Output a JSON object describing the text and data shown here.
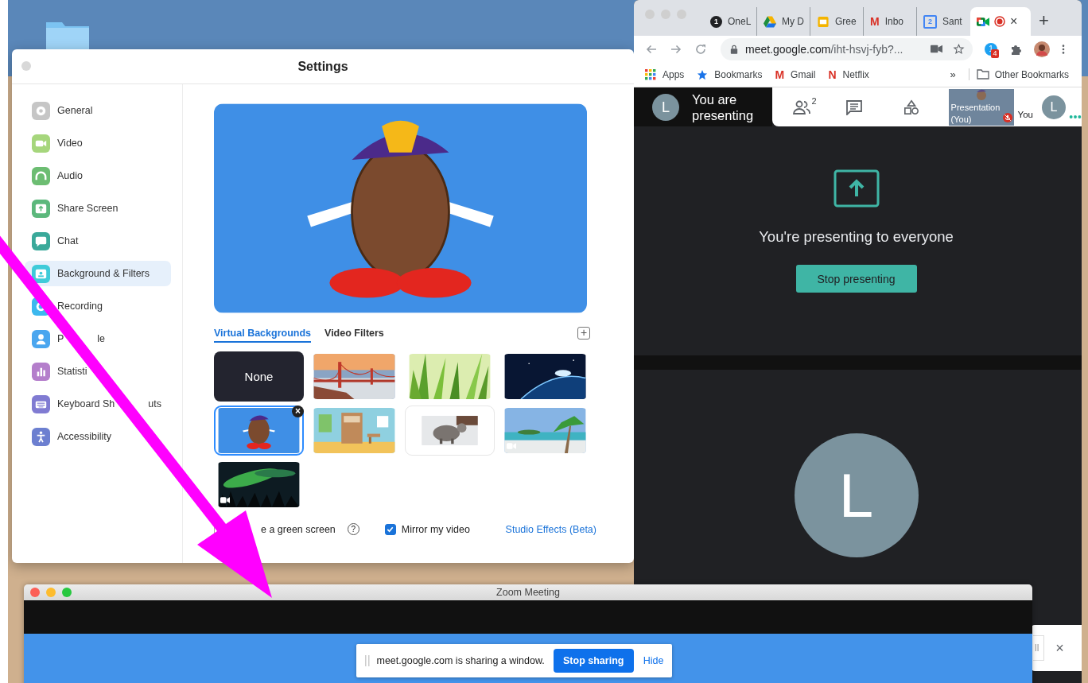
{
  "settings": {
    "title": "Settings",
    "sidebar": [
      {
        "label": "General",
        "kind": "gear",
        "color": "#c6c6c6",
        "selected": false
      },
      {
        "label": "Video",
        "kind": "video",
        "color": "#a6d67c",
        "selected": false
      },
      {
        "label": "Audio",
        "kind": "headphones",
        "color": "#6cbd72",
        "selected": false
      },
      {
        "label": "Share Screen",
        "kind": "share",
        "color": "#5cb87c",
        "selected": false
      },
      {
        "label": "Chat",
        "kind": "chat",
        "color": "#3aa99a",
        "selected": false
      },
      {
        "label": "Background & Filters",
        "kind": "card",
        "color": "#3fcbd9",
        "selected": true
      },
      {
        "label": "Recording",
        "kind": "record",
        "color": "#3cb8ee",
        "selected": false
      },
      {
        "label": "P",
        "label_tail": "le",
        "kind": "person",
        "color": "#4aa6ef",
        "selected": false
      },
      {
        "label": "Statisti",
        "kind": "bars",
        "color": "#b47ecb",
        "selected": false
      },
      {
        "label": "Keyboard Sh",
        "label_tail": "uts",
        "kind": "keyboard",
        "color": "#807bd2",
        "selected": false
      },
      {
        "label": "Accessibility",
        "kind": "accessibility",
        "color": "#6c7fd0",
        "selected": false
      }
    ],
    "tabs": [
      {
        "label": "Virtual Backgrounds",
        "selected": true
      },
      {
        "label": "Video Filters",
        "selected": false
      }
    ],
    "add": "+",
    "backgrounds": [
      {
        "kind": "none",
        "label": "None",
        "selected": false
      },
      {
        "kind": "bridge",
        "selected": false
      },
      {
        "kind": "grass",
        "selected": false
      },
      {
        "kind": "space",
        "selected": false
      },
      {
        "kind": "figure",
        "selected": true,
        "remove": "×"
      },
      {
        "kind": "room",
        "selected": false
      },
      {
        "kind": "animal",
        "selected": false
      },
      {
        "kind": "beach",
        "selected": false,
        "video": true
      },
      {
        "kind": "aurora",
        "selected": false,
        "video": true
      }
    ],
    "options": [
      {
        "kind": "checkbox",
        "label": "e a green screen",
        "checked": false,
        "help": "?"
      },
      {
        "kind": "checkbox",
        "label": "Mirror my video",
        "checked": true
      },
      {
        "kind": "link",
        "label": "Studio Effects (Beta)"
      }
    ]
  },
  "browser": {
    "tabs": [
      {
        "label": "OneL",
        "kind": "number",
        "icon_text": "1",
        "selected": false
      },
      {
        "label": "My D",
        "kind": "triangle",
        "selected": false
      },
      {
        "label": "Gree",
        "kind": "slides",
        "selected": false
      },
      {
        "label": "Inbo",
        "kind": "letter",
        "icon_text": "M",
        "selected": false
      },
      {
        "label": "Sant",
        "kind": "calendar",
        "icon_text": "2",
        "selected": false
      },
      {
        "kind": "meet",
        "recording": true,
        "close": "×",
        "selected": true
      }
    ],
    "new_tab": "+",
    "url_host": "meet.google.com",
    "url_path": "/iht-hsvj-fyb?...",
    "extension_text": "1",
    "extension_badge": "4",
    "bookmarks": [
      {
        "label": "Apps",
        "kind": "grid"
      },
      {
        "label": "Bookmarks",
        "kind": "star"
      },
      {
        "label": "Gmail",
        "kind": "letter",
        "icon_text": "M"
      },
      {
        "label": "Netflix",
        "kind": "letter",
        "icon_text": "N"
      }
    ],
    "more": "»",
    "other": "Other Bookmarks"
  },
  "meet": {
    "avatar": "L",
    "presenting": "You are presenting",
    "people_count": "2",
    "presentation": "Presentation (You)",
    "you": "You",
    "you_avatar": "L",
    "message": "You're presenting to everyone",
    "stop": "Stop presenting",
    "tile_avatar": "L",
    "popup_button": "ll",
    "popup_close": "×"
  },
  "zoom": {
    "title": "Zoom Meeting",
    "share_text": "meet.google.com is sharing a window.",
    "stop": "Stop sharing",
    "hide": "Hide"
  }
}
